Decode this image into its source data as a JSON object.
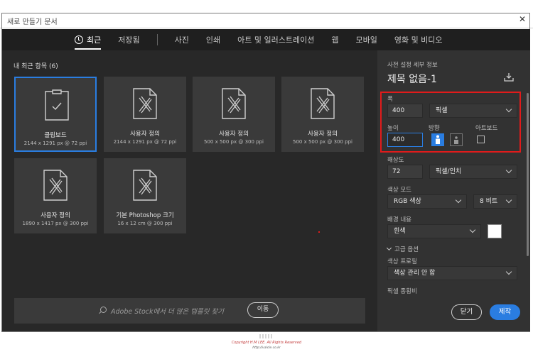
{
  "window": {
    "title": "새로 만들기 문서",
    "close_glyph": "✕"
  },
  "tabs": [
    {
      "label": "최근",
      "active": true
    },
    {
      "label": "저장됨"
    },
    {
      "label": "사진"
    },
    {
      "label": "인쇄"
    },
    {
      "label": "아트 및 일러스트레이션"
    },
    {
      "label": "웹"
    },
    {
      "label": "모바일"
    },
    {
      "label": "영화 및 비디오"
    }
  ],
  "recent": {
    "title": "내 최근 항목 (6)",
    "items": [
      {
        "name": "클립보드",
        "dims": "2144 x 1291 px @ 72 ppi",
        "icon": "clipboard-doc-icon",
        "selected": true
      },
      {
        "name": "사용자 정의",
        "dims": "2144 x 1291 px @ 72 ppi",
        "icon": "custom-doc-icon"
      },
      {
        "name": "사용자 정의",
        "dims": "500 x 500 px @ 300 ppi",
        "icon": "custom-doc-icon"
      },
      {
        "name": "사용자 정의",
        "dims": "500 x 500 px @ 300 ppi",
        "icon": "custom-doc-icon"
      },
      {
        "name": "사용자 정의",
        "dims": "1890 x 1417 px @ 300 ppi",
        "icon": "custom-doc-icon"
      },
      {
        "name": "기본 Photoshop 크기",
        "dims": "16 x 12 cm @ 300 ppi",
        "icon": "custom-doc-icon"
      }
    ]
  },
  "stock": {
    "placeholder": "Adobe Stock에서 더 많은 템플릿 찾기",
    "go_label": "이동"
  },
  "preset": {
    "header": "사전 설정 세부 정보",
    "doc_title": "제목 없음-1",
    "width_label": "폭",
    "width_value": "400",
    "width_unit": "픽셀",
    "height_label": "높이",
    "height_value": "400",
    "orientation_label": "방향",
    "artboard_label": "아트보드",
    "resolution_label": "해상도",
    "resolution_value": "72",
    "resolution_unit": "픽셀/인치",
    "color_mode_label": "색상 모드",
    "color_mode_value": "RGB 색상",
    "bit_depth": "8 비트",
    "background_label": "배경 내용",
    "background_value": "흰색",
    "background_color": "#ffffff",
    "advanced_label": "고급 옵션",
    "color_profile_label": "색상 프로필",
    "color_profile_value": "색상 관리 안 함",
    "pixel_aspect_label": "픽셀 종횡비",
    "close_label": "닫기",
    "create_label": "제작"
  },
  "footer": {
    "line1": "Copyright H.M LEE. All Rights Reserved",
    "line2": "http://valcle.co.kr"
  },
  "colors": {
    "accent": "#2a7de1",
    "highlight": "#e01b1b",
    "panel": "#323232",
    "background": "#1f1f1f"
  }
}
